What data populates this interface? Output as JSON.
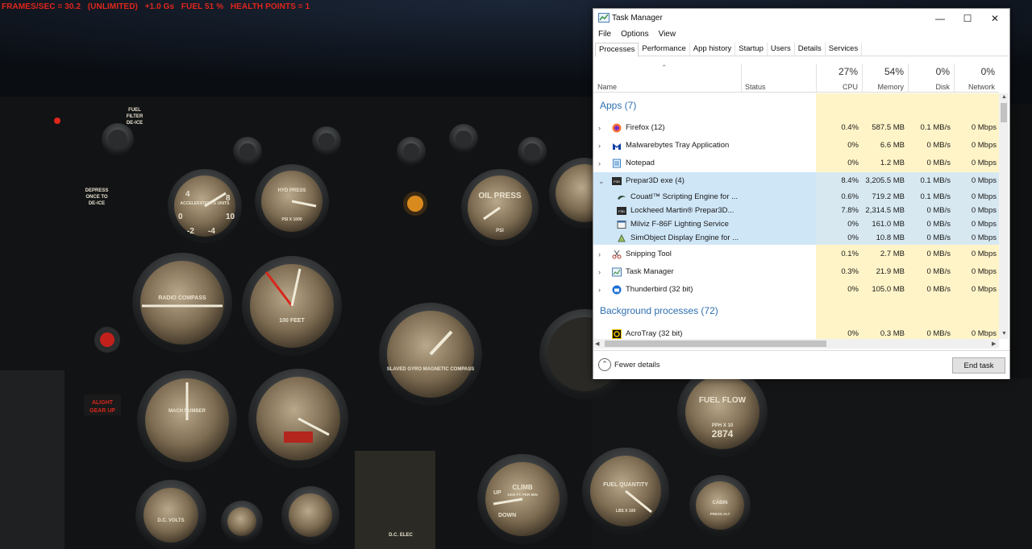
{
  "hud": {
    "text": "FRAMES/SEC = 30.2   (UNLIMITED)   +1.0 Gs   FUEL 51 %   HEALTH POINTS = 1"
  },
  "cockpit": {
    "placards": [
      "FUEL",
      "FILTER",
      "DE-ICE",
      "DEPRESS",
      "ONCE TO",
      "DE-ICE",
      "ALIGHT",
      "GEAR UP"
    ],
    "gauges": {
      "accel": "ACCELERATION G UNITS",
      "hyd": "HYD PRESS",
      "hyd_unit": "PSI X 1000",
      "oil": "OIL PRESS",
      "oil_unit": "PSI",
      "radio": "RADIO COMPASS",
      "alt": "100 FEET",
      "gyro": "SLAVED GYRO MAGNETIC COMPASS",
      "mach": "MACH NUMBER",
      "fuelflow": "FUEL FLOW",
      "fuelflow_unit": "PPH X 10",
      "fuelflow_counter": "2874",
      "climb": "CLIMB",
      "climb_unit": "1000 FT. PER MIN",
      "up": "UP",
      "down": "DOWN",
      "fuelqty": "FUEL QUANTITY",
      "fuelqty_unit": "LBS X 100",
      "cabin": "CABIN",
      "cabin_unit": "PRESS ALT",
      "dcvolts": "D.C. VOLTS",
      "dcelec": "D.C. ELEC"
    }
  },
  "window": {
    "title": "Task Manager",
    "controls": {
      "minimize": "—",
      "maximize": "☐",
      "close": "✕"
    }
  },
  "menu": [
    "File",
    "Options",
    "View"
  ],
  "tabs": [
    "Processes",
    "Performance",
    "App history",
    "Startup",
    "Users",
    "Details",
    "Services"
  ],
  "active_tab": "Processes",
  "header": {
    "sort_glyph": "⌃",
    "name": "Name",
    "status": "Status",
    "cpu": {
      "pct": "27%",
      "label": "CPU"
    },
    "memory": {
      "pct": "54%",
      "label": "Memory"
    },
    "disk": {
      "pct": "0%",
      "label": "Disk"
    },
    "network": {
      "pct": "0%",
      "label": "Network"
    }
  },
  "groups": {
    "apps": "Apps (7)",
    "background": "Background processes (72)"
  },
  "rows": [
    {
      "name": "Firefox (12)",
      "cpu": "0.4%",
      "mem": "587.5 MB",
      "disk": "0.1 MB/s",
      "net": "0 Mbps"
    },
    {
      "name": "Malwarebytes Tray Application",
      "cpu": "0%",
      "mem": "6.6 MB",
      "disk": "0 MB/s",
      "net": "0 Mbps"
    },
    {
      "name": "Notepad",
      "cpu": "0%",
      "mem": "1.2 MB",
      "disk": "0 MB/s",
      "net": "0 Mbps"
    },
    {
      "name": "Prepar3D exe (4)",
      "cpu": "8.4%",
      "mem": "3,205.5 MB",
      "disk": "0.1 MB/s",
      "net": "0 Mbps"
    },
    {
      "name": "Couatl™ Scripting Engine for ...",
      "cpu": "0.6%",
      "mem": "719.2 MB",
      "disk": "0.1 MB/s",
      "net": "0 Mbps"
    },
    {
      "name": "Lockheed Martin® Prepar3D...",
      "cpu": "7.8%",
      "mem": "2,314.5 MB",
      "disk": "0 MB/s",
      "net": "0 Mbps"
    },
    {
      "name": "Milviz F-86F Lighting Service",
      "cpu": "0%",
      "mem": "161.0 MB",
      "disk": "0 MB/s",
      "net": "0 Mbps"
    },
    {
      "name": "SimObject Display Engine for ...",
      "cpu": "0%",
      "mem": "10.8 MB",
      "disk": "0 MB/s",
      "net": "0 Mbps"
    },
    {
      "name": "Snipping Tool",
      "cpu": "0.1%",
      "mem": "2.7 MB",
      "disk": "0 MB/s",
      "net": "0 Mbps"
    },
    {
      "name": "Task Manager",
      "cpu": "0.3%",
      "mem": "21.9 MB",
      "disk": "0 MB/s",
      "net": "0 Mbps"
    },
    {
      "name": "Thunderbird (32 bit)",
      "cpu": "0%",
      "mem": "105.0 MB",
      "disk": "0 MB/s",
      "net": "0 Mbps"
    },
    {
      "name": "AcroTray (32 bit)",
      "cpu": "0%",
      "mem": "0.3 MB",
      "disk": "0 MB/s",
      "net": "0 Mbps"
    }
  ],
  "chevrons": {
    "collapsed": "›",
    "expanded": "⌄"
  },
  "scroll": {
    "up": "▲",
    "down": "▼",
    "left": "◀",
    "right": "▶"
  },
  "footer": {
    "fewer_details": "Fewer details",
    "fewer_glyph": "⌃",
    "end_task": "End task"
  },
  "colors": {
    "accent": "#2f6fb0",
    "heat": "#fff4c8",
    "selected": "#cfe6f7",
    "hud": "#e0261c"
  }
}
